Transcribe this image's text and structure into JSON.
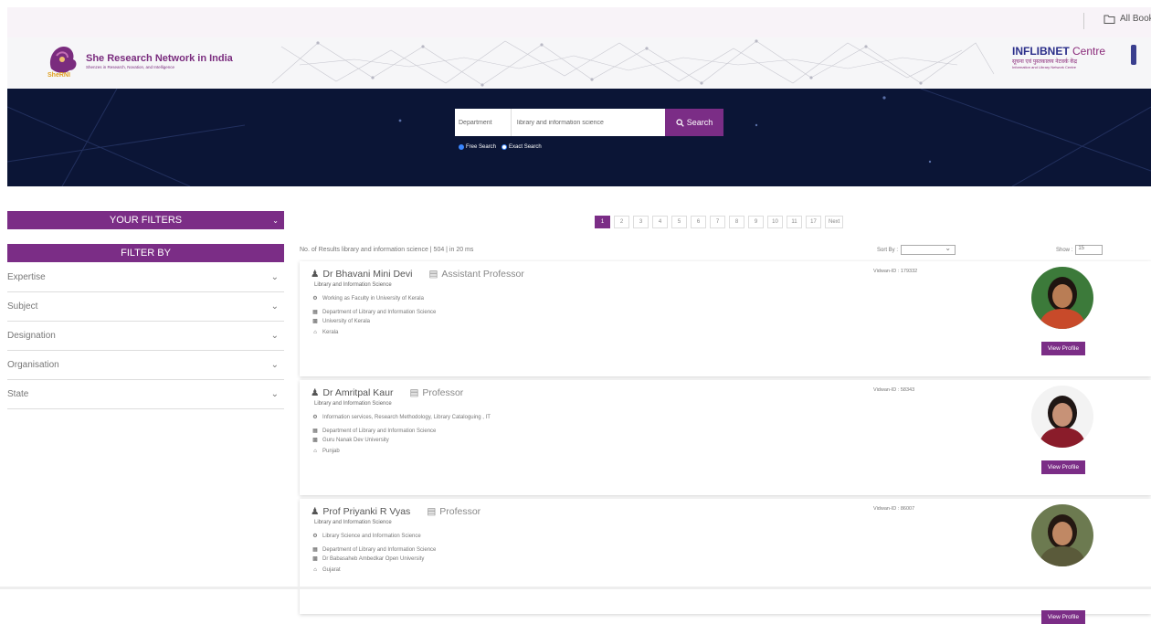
{
  "topbar": {
    "all_books": "All Books"
  },
  "header": {
    "org_title": "She Research Network in India",
    "org_subtitle": "Shenzes in Research, Novation, and Intelligence",
    "logo_text": "SheRNI",
    "partner_name": "INFLIBNET",
    "partner_suffix": "Centre",
    "partner_hindi": "सूचना एवं पुस्तकालय नेटवर्क केंद्र",
    "partner_sub": "Information and Library Network Centre"
  },
  "search": {
    "field_label": "Department",
    "value": "library and information science",
    "button_label": "Search",
    "modes": [
      "Free Search",
      "Exact Search"
    ]
  },
  "sidebar": {
    "your_filters": "YOUR FILTERS",
    "filter_by": "FILTER BY",
    "filters": [
      "Expertise",
      "Subject",
      "Designation",
      "Organisation",
      "State"
    ]
  },
  "pagination": {
    "pages": [
      "1",
      "2",
      "3",
      "4",
      "5",
      "6",
      "7",
      "8",
      "9",
      "10",
      "11",
      "17",
      "Next"
    ],
    "active_index": 0
  },
  "results": {
    "summary": "No. of Results library and information science | 504 | in 20 ms",
    "sort_label": "Sort By :",
    "show_label": "Show :",
    "show_value": "15"
  },
  "experts": [
    {
      "name": "Dr Bhavani Mini Devi",
      "designation": "Assistant Professor",
      "department_line": "Library and Information Science",
      "expertise": "Working as Faculty in University of Kerala",
      "department": "Department of Library and Information Science",
      "university": "University of Kerala",
      "state": "Kerala",
      "vidwan_id": "Vidwan-ID : 179332",
      "view_label": "View Profile"
    },
    {
      "name": "Dr Amritpal Kaur",
      "designation": "Professor",
      "department_line": "Library and Information Science",
      "expertise": "Information services, Research Methodology, Library Cataloguing , IT",
      "department": "Department of Library and Information Science",
      "university": "Guru Nanak Dev University",
      "state": "Punjab",
      "vidwan_id": "Vidwan-ID : 58343",
      "view_label": "View Profile"
    },
    {
      "name": "Prof Priyanki R Vyas",
      "designation": "Professor",
      "department_line": "Library and Information Science",
      "expertise": "Library Science and Information Science",
      "department": "Department of Library and Information Science",
      "university": "Dr Babasaheb Ambedkar Open University",
      "state": "Gujarat",
      "vidwan_id": "Vidwan-ID : 86007",
      "view_label": "View Profile"
    }
  ],
  "colors": {
    "brand": "#7b2d86",
    "hero": "#0b1536"
  }
}
